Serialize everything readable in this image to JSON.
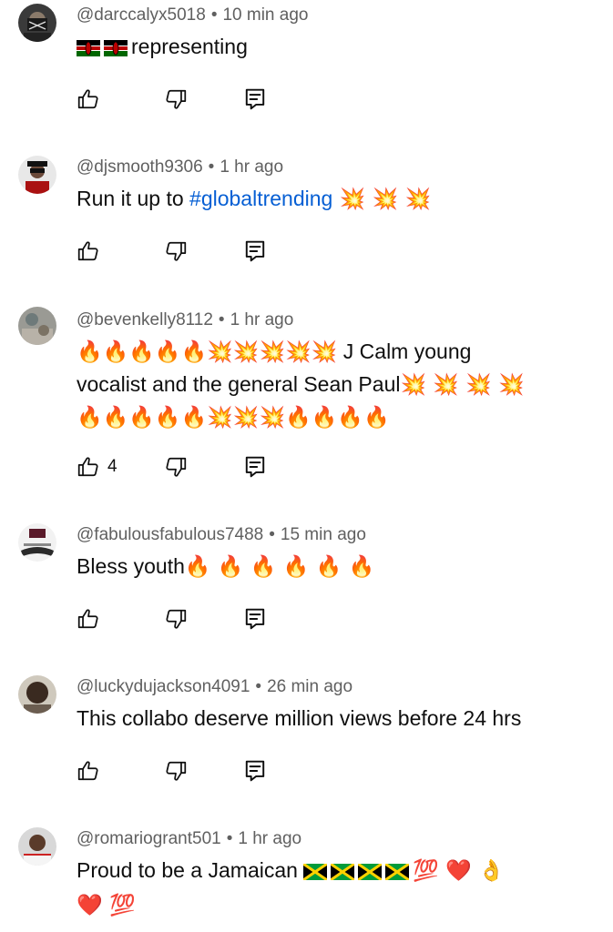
{
  "comments": [
    {
      "author": "@darccalyx5018",
      "time": "10 min ago",
      "text_suffix": "representing",
      "flags": [
        "kenya",
        "kenya"
      ],
      "likes": ""
    },
    {
      "author": "@djsmooth9306",
      "time": "1 hr ago",
      "text_prefix": "Run it up to ",
      "hashtag": "#globaltrending",
      "emoji_suffix": " 💥 💥 💥",
      "likes": ""
    },
    {
      "author": "@bevenkelly8112",
      "time": "1 hr ago",
      "line1_emoji": "🔥🔥🔥🔥🔥💥💥💥💥💥",
      "line1_text": "J Calm young",
      "line2_text": "vocalist and the general Sean Paul",
      "line2_emoji": "💥 💥 💥 💥",
      "line3_emoji": "🔥🔥🔥🔥🔥💥💥💥🔥🔥🔥🔥",
      "likes": "4"
    },
    {
      "author": "@fabulousfabulous7488",
      "time": "15 min ago",
      "text": "Bless youth",
      "emoji_suffix": "🔥 🔥 🔥 🔥 🔥 🔥",
      "likes": ""
    },
    {
      "author": "@luckydujackson4091",
      "time": "26 min ago",
      "text": "This collabo deserve million views before 24 hrs",
      "likes": ""
    },
    {
      "author": "@romariogrant501",
      "time": "1 hr ago",
      "text": "Proud to be a Jamaican",
      "flags": [
        "jamaica",
        "jamaica",
        "jamaica",
        "jamaica"
      ],
      "emoji_suffix": "💯 ❤️ 👌",
      "line2_emoji": "❤️ 💯",
      "likes": ""
    }
  ],
  "separator": "•",
  "icons": {
    "like": "thumbs-up-icon",
    "dislike": "thumbs-down-icon",
    "reply": "reply-comment-icon"
  },
  "colors": {
    "meta_text": "#606060",
    "hashtag": "#065fd4",
    "text": "#0f0f0f"
  }
}
